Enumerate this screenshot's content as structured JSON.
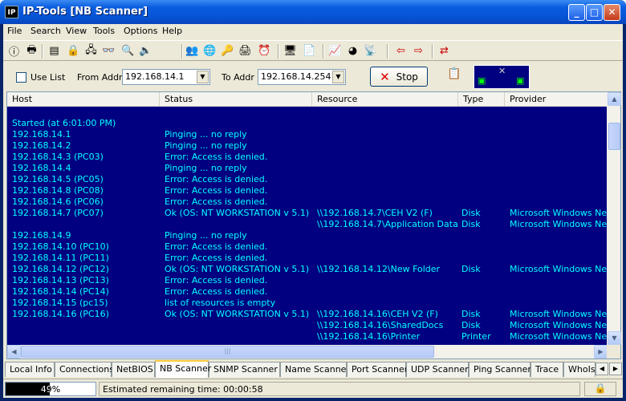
{
  "window": {
    "title": "IP-Tools [NB Scanner]",
    "app_icon_text": "IP"
  },
  "menu": [
    "File",
    "Search",
    "View",
    "Tools",
    "Options",
    "Help"
  ],
  "toolbar_icons": [
    "info-icon",
    "printer-icon",
    "window-icon",
    "lock-icon",
    "network-icon",
    "binoculars-icon",
    "finder-icon",
    "speaker-icon",
    "people-icon",
    "globe-icon",
    "key-icon",
    "print-icon",
    "clock-icon",
    "monitor-icon",
    "document-icon",
    "chart-icon",
    "pie-icon",
    "satellite-icon",
    "arrow-left-icon",
    "arrow-right-icon",
    "arrows-swap-icon"
  ],
  "options": {
    "use_list_label": "Use List",
    "use_list_checked": false,
    "from_label": "From Addr",
    "from_value": "192.168.14.1",
    "to_label": "To Addr",
    "to_value": "192.168.14.254",
    "stop_label": "Stop"
  },
  "columns": [
    "Host",
    "Status",
    "Resource",
    "Type",
    "Provider"
  ],
  "started": "Started (at 6:01:00 PM)",
  "rows": [
    {
      "host": "192.168.14.1",
      "status": "Pinging ... no reply",
      "resource": "",
      "type": "",
      "provider": ""
    },
    {
      "host": "192.168.14.2",
      "status": "Pinging ... no reply",
      "resource": "",
      "type": "",
      "provider": ""
    },
    {
      "host": "192.168.14.3 (PC03)",
      "status": "Error: Access is denied.",
      "resource": "",
      "type": "",
      "provider": ""
    },
    {
      "host": "192.168.14.4",
      "status": "Pinging ... no reply",
      "resource": "",
      "type": "",
      "provider": ""
    },
    {
      "host": "192.168.14.5 (PC05)",
      "status": "Error: Access is denied.",
      "resource": "",
      "type": "",
      "provider": ""
    },
    {
      "host": "192.168.14.8 (PC08)",
      "status": "Error: Access is denied.",
      "resource": "",
      "type": "",
      "provider": ""
    },
    {
      "host": "192.168.14.6 (PC06)",
      "status": "Error: Access is denied.",
      "resource": "",
      "type": "",
      "provider": ""
    },
    {
      "host": "192.168.14.7 (PC07)",
      "status": "Ok (OS: NT WORKSTATION v 5.1)",
      "resource": "\\\\192.168.14.7\\CEH V2 (F)",
      "type": "Disk",
      "provider": "Microsoft Windows Netw"
    },
    {
      "host": "",
      "status": "",
      "resource": "\\\\192.168.14.7\\Application Data",
      "type": "Disk",
      "provider": "Microsoft Windows Netw"
    },
    {
      "host": "192.168.14.9",
      "status": "Pinging ... no reply",
      "resource": "",
      "type": "",
      "provider": ""
    },
    {
      "host": "192.168.14.10 (PC10)",
      "status": "Error: Access is denied.",
      "resource": "",
      "type": "",
      "provider": ""
    },
    {
      "host": "192.168.14.11 (PC11)",
      "status": "Error: Access is denied.",
      "resource": "",
      "type": "",
      "provider": ""
    },
    {
      "host": "192.168.14.12 (PC12)",
      "status": "Ok (OS: NT WORKSTATION v 5.1)",
      "resource": "\\\\192.168.14.12\\New Folder",
      "type": "Disk",
      "provider": "Microsoft Windows Netw"
    },
    {
      "host": "192.168.14.13 (PC13)",
      "status": "Error: Access is denied.",
      "resource": "",
      "type": "",
      "provider": ""
    },
    {
      "host": "192.168.14.14 (PC14)",
      "status": "Error: Access is denied.",
      "resource": "",
      "type": "",
      "provider": ""
    },
    {
      "host": "192.168.14.15 (pc15)",
      "status": "list of resources is empty",
      "resource": "",
      "type": "",
      "provider": ""
    },
    {
      "host": "192.168.14.16 (PC16)",
      "status": "Ok (OS: NT WORKSTATION v 5.1)",
      "resource": "\\\\192.168.14.16\\CEH V2 (F)",
      "type": "Disk",
      "provider": "Microsoft Windows Netw"
    },
    {
      "host": "",
      "status": "",
      "resource": "\\\\192.168.14.16\\SharedDocs",
      "type": "Disk",
      "provider": "Microsoft Windows Netw"
    },
    {
      "host": "",
      "status": "",
      "resource": "\\\\192.168.14.16\\Printer",
      "type": "Printer",
      "provider": "Microsoft Windows Netw"
    }
  ],
  "tabs": [
    "Local Info",
    "Connections",
    "NetBIOS",
    "NB Scanner",
    "SNMP Scanner",
    "Name Scanner",
    "Port Scanner",
    "UDP Scanner",
    "Ping Scanner",
    "Trace",
    "WhoIs"
  ],
  "active_tab": "NB Scanner",
  "status": {
    "progress_percent": 49,
    "progress_label": "49%",
    "message": "Estimated remaining time: 00:00:58"
  },
  "colors": {
    "list_bg": "#000080",
    "list_text": "#00ffff",
    "title_bar": "#0a5ddf"
  }
}
